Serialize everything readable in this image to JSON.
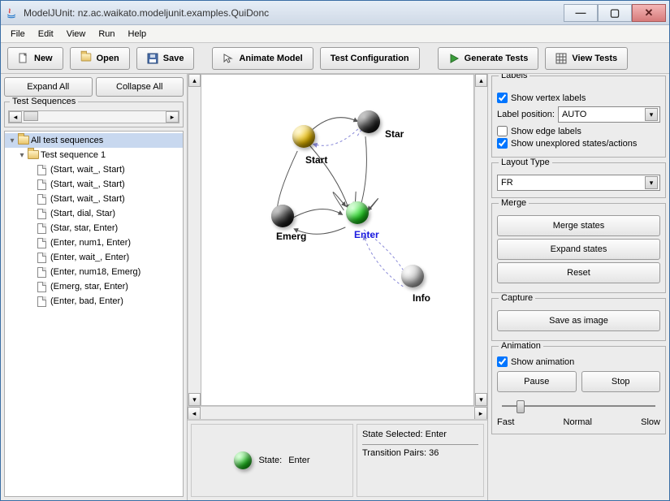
{
  "window": {
    "title": "ModelJUnit: nz.ac.waikato.modeljunit.examples.QuiDonc"
  },
  "menu": {
    "file": "File",
    "edit": "Edit",
    "view": "View",
    "run": "Run",
    "help": "Help"
  },
  "toolbar": {
    "new": "New",
    "open": "Open",
    "save": "Save",
    "animate": "Animate Model",
    "testconfig": "Test Configuration",
    "generate": "Generate Tests",
    "viewtests": "View Tests"
  },
  "left": {
    "expand_all": "Expand All",
    "collapse_all": "Collapse All",
    "test_sequences": "Test Sequences",
    "root": "All test sequences",
    "seq1": "Test sequence 1",
    "steps": [
      "(Start, wait_, Start)",
      "(Start, wait_, Start)",
      "(Start, wait_, Start)",
      "(Start, dial, Star)",
      "(Star, star, Enter)",
      "(Enter, num1, Enter)",
      "(Enter, wait_, Enter)",
      "(Enter, num18, Emerg)",
      "(Emerg, star, Enter)",
      "(Enter, bad, Enter)"
    ]
  },
  "graph": {
    "nodes": {
      "start": "Start",
      "star": "Star",
      "emerg": "Emerg",
      "enter": "Enter",
      "info": "Info"
    }
  },
  "status": {
    "state_label": "State:",
    "state_value": "Enter",
    "selected": "State Selected: Enter",
    "pairs": "Transition Pairs: 36"
  },
  "right": {
    "labels_legend": "Labels",
    "show_vertex": "Show vertex labels",
    "label_position": "Label position:",
    "auto": "AUTO",
    "show_edge": "Show edge labels",
    "show_unexplored": "Show unexplored states/actions",
    "layout_legend": "Layout Type",
    "layout_value": "FR",
    "merge_legend": "Merge",
    "merge_states": "Merge states",
    "expand_states": "Expand states",
    "reset": "Reset",
    "capture_legend": "Capture",
    "save_image": "Save as image",
    "animation_legend": "Animation",
    "show_animation": "Show animation",
    "pause": "Pause",
    "stop": "Stop",
    "fast": "Fast",
    "normal": "Normal",
    "slow": "Slow"
  }
}
